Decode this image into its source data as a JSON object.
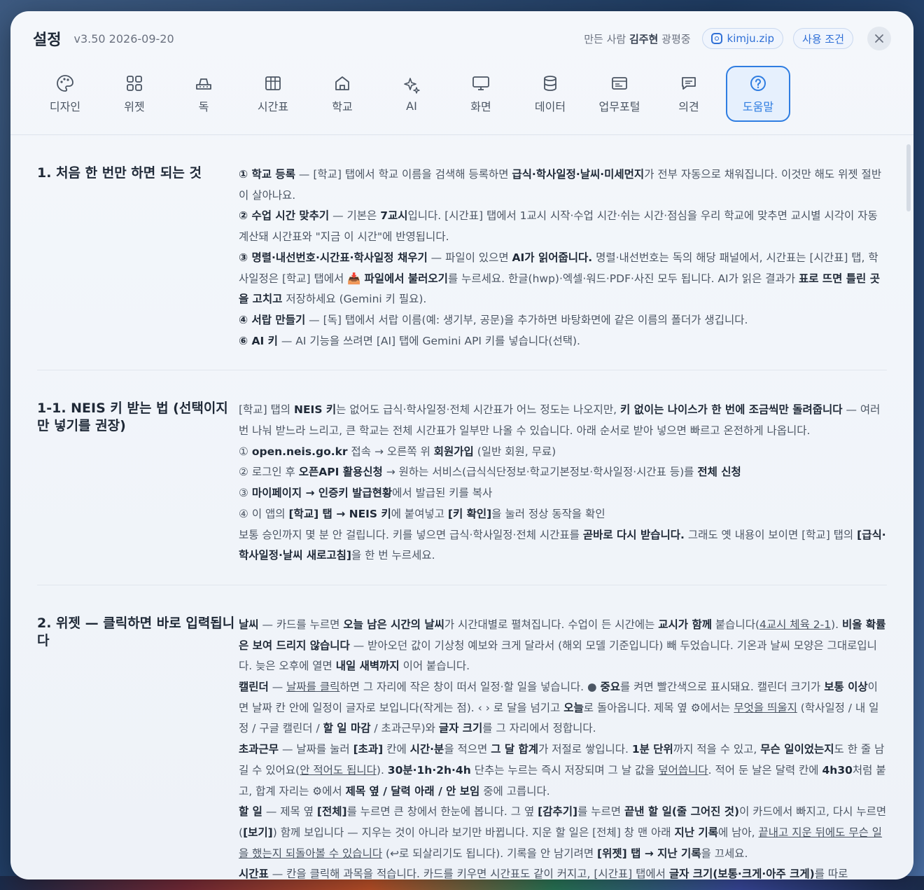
{
  "header": {
    "title": "설정",
    "version": "v3.50 2026-09-20",
    "maker_prefix": "만든 사람",
    "maker_name": "김주현",
    "maker_suffix": "광평중",
    "instagram_label": "kimju.zip",
    "terms_label": "사용 조건",
    "close_icon": "close-icon"
  },
  "tabs": [
    {
      "label": "디자인",
      "icon": "palette-icon"
    },
    {
      "label": "위젯",
      "icon": "grid-icon"
    },
    {
      "label": "독",
      "icon": "dock-icon"
    },
    {
      "label": "시간표",
      "icon": "table-icon"
    },
    {
      "label": "학교",
      "icon": "school-icon"
    },
    {
      "label": "AI",
      "icon": "sparkle-icon"
    },
    {
      "label": "화면",
      "icon": "monitor-icon"
    },
    {
      "label": "데이터",
      "icon": "database-icon"
    },
    {
      "label": "업무포털",
      "icon": "portal-icon"
    },
    {
      "label": "의견",
      "icon": "chat-icon"
    },
    {
      "label": "도움말",
      "icon": "help-icon",
      "active": true
    }
  ],
  "sections": [
    {
      "title": "1. 처음 한 번만 하면 되는 것",
      "body": [
        "<b>① 학교 등록</b> — [학교] 탭에서 학교 이름을 검색해 등록하면 <b>급식·학사일정·날씨·미세먼지</b>가 전부 자동으로 채워집니다. 이것만 해도 위젯 절반이 살아나요.",
        "<b>② 수업 시간 맞추기</b> — 기본은 <b>7교시</b>입니다. [시간표] 탭에서 1교시 시작·수업 시간·쉬는 시간·점심을 우리 학교에 맞추면 교시별 시각이 자동 계산돼 시간표와 \"지금 이 시간\"에 반영됩니다.",
        "<b>③ 명렬·내선번호·시간표·학사일정 채우기</b> — 파일이 있으면 <b>AI가 읽어줍니다.</b> 명렬·내선번호는 독의 해당 패널에서, 시간표는 [시간표] 탭, 학사일정은 [학교] 탭에서 📥 <b>파일에서 불러오기</b>를 누르세요. 한글(hwp)·엑셀·워드·PDF·사진 모두 됩니다. AI가 읽은 결과가 <b>표로 뜨면 틀린 곳을 고치고</b> 저장하세요 (Gemini 키 필요).",
        "<b>④ 서랍 만들기</b> — [독] 탭에서 서랍 이름(예: 생기부, 공문)을 추가하면 바탕화면에 같은 이름의 폴더가 생깁니다.",
        "<b>⑥ AI 키</b> — AI 기능을 쓰려면 [AI] 탭에 Gemini API 키를 넣습니다(선택)."
      ]
    },
    {
      "title": "1-1. NEIS 키 받는 법 (선택이지만 넣기를 권장)",
      "body": [
        "[학교] 탭의 <b>NEIS 키</b>는 없어도 급식·학사일정·전체 시간표가 어느 정도는 나오지만, <b>키 없이는 나이스가 한 번에 조금씩만 돌려줍니다</b> — 여러 번 나눠 받느라 느리고, 큰 학교는 전체 시간표가 일부만 나올 수 있습니다. 아래 순서로 받아 넣으면 빠르고 온전하게 나옵니다.",
        "① <b>open.neis.go.kr</b> 접속 → 오른쪽 위 <b>회원가입</b> (일반 회원, 무료)",
        "② 로그인 후 <b>오픈API 활용신청</b> → 원하는 서비스(급식식단정보·학교기본정보·학사일정·시간표 등)를 <b>전체 신청</b>",
        "③ <b>마이페이지 → 인증키 발급현황</b>에서 발급된 키를 복사",
        "④ 이 앱의 <b>[학교] 탭 → NEIS 키</b>에 붙여넣고 <b>[키 확인]</b>을 눌러 정상 동작을 확인",
        "보통 승인까지 몇 분 안 걸립니다. 키를 넣으면 급식·학사일정·전체 시간표를 <b>곧바로 다시 받습니다.</b> 그래도 옛 내용이 보이면 [학교] 탭의 <b>[급식·학사일정·날씨 새로고침]</b>을 한 번 누르세요."
      ]
    },
    {
      "title": "2. 위젯 — 클릭하면 바로 입력됩니다",
      "body": [
        "<b>날씨</b> — 카드를 누르면 <b>오늘 남은 시간의 날씨</b>가 시간대별로 펼쳐집니다. 수업이 든 시간에는 <b>교시가 함께</b> 붙습니다(<u>4교시 체육 2-1</u>). <b>비올 확률은 보여 드리지 않습니다</b> — 받아오던 값이 기상청 예보와 크게 달라서 (해외 모델 기준입니다) 빼 두었습니다. 기온과 날씨 모양은 그대로입니다. 늦은 오후에 열면 <b>내일 새벽까지</b> 이어 붙습니다.",
        "<b>캘린더</b> — <u>날짜를 클릭</u>하면 그 자리에 작은 창이 떠서 일정·할 일을 넣습니다. ● <b>중요</b>를 켜면 빨간색으로 표시돼요. 캘린더 크기가 <b>보통 이상</b>이면 날짜 칸 안에 일정이 글자로 보입니다(작게는 점). ‹ › 로 달을 넘기고 <b>오늘</b>로 돌아옵니다. 제목 옆 ⚙에서는 <u>무엇을 띄울지</u> (학사일정 / 내 일정 / 구글 캘린더 / <b>할 일 마감</b> / 초과근무)와 <b>글자 크기</b>를 그 자리에서 정합니다.",
        "<b>초과근무</b> — 날짜를 눌러 <b>[초과]</b> 칸에 <b>시간·분</b>을 적으면 <b>그 달 합계</b>가 저절로 쌓입니다. <b>1분 단위</b>까지 적을 수 있고, <b>무슨 일이었는지</b>도 한 줄 남길 수 있어요(<u>안 적어도 됩니다</u>). <b>30분·1h·2h·4h</b> 단추는 누르는 즉시 저장되며 그 날 값을 <u>덮어씁니다</u>. 적어 둔 날은 달력 칸에 <b>4h30</b>처럼 붙고, 합계 자리는 ⚙에서 <b>제목 옆 / 달력 아래 / 안 보임</b> 중에 고릅니다.",
        "<b>할 일</b> — 제목 옆 <b>[전체]</b>를 누르면 큰 창에서 한눈에 봅니다. 그 옆 <b>[감추기]</b>를 누르면 <b>끝낸 할 일(줄 그어진 것)</b>이 카드에서 빠지고, 다시 누르면(<b>[보기]</b>) 함께 보입니다 — 지우는 것이 아니라 보기만 바뀝니다. 지운 할 일은 [전체] 창 맨 아래 <b>지난 기록</b>에 남아, <u>끝내고 지운 뒤에도 무슨 일을 했는지 되돌아볼 수 있습니다</u> (↩로 되살리기도 됩니다). 기록을 안 남기려면 <b>[위젯] 탭 → 지난 기록</b>을 끄세요.",
        "<b>시간표</b> — 칸을 클릭해 과목을 적습니다. 카드를 키우면 시간표도 같이 커지고, [시간표] 탭에서 <b>글자 크기(보통·크게·아주 크게)</b>를 따로"
      ]
    }
  ]
}
